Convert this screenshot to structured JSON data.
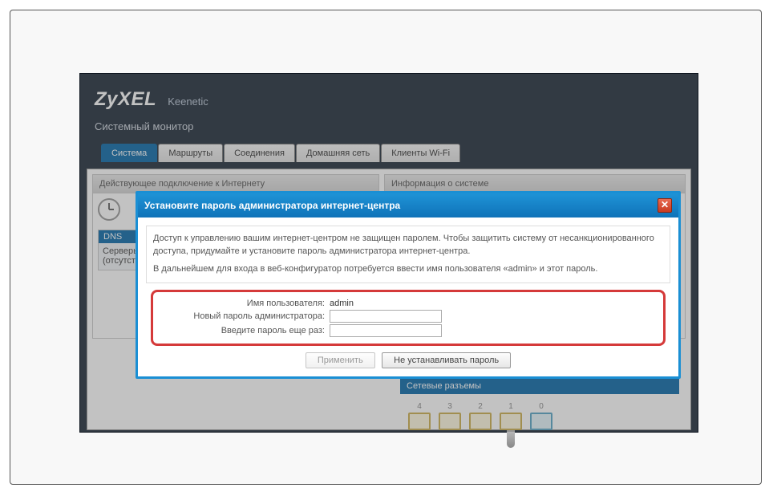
{
  "brand": {
    "logo": "ZyXEL",
    "model": "Keenetic"
  },
  "subtitle": "Системный монитор",
  "tabs": [
    "Система",
    "Маршруты",
    "Соединения",
    "Домашняя сеть",
    "Клиенты Wi-Fi"
  ],
  "active_tab": 0,
  "panels": {
    "left_title": "Действующее подключение к Интернету",
    "right_title": "Информация о системе"
  },
  "side": {
    "dns_title": "DNS",
    "servers_label": "Серверы",
    "servers_value": "(отсутствуют)"
  },
  "network": {
    "title": "Сетевые разъемы",
    "ports": [
      "4",
      "3",
      "2",
      "1",
      "0"
    ]
  },
  "dialog": {
    "title": "Установите пароль администратора интернет-центра",
    "paragraph1": "Доступ к управлению вашим интернет-центром не защищен паролем. Чтобы защитить систему от несанкционированного доступа, придумайте и установите пароль администратора интернет-центра.",
    "paragraph2": "В дальнейшем для входа в веб-конфигуратор потребуется ввести имя пользователя «admin» и этот пароль.",
    "username_label": "Имя пользователя:",
    "username_value": "admin",
    "password_label": "Новый пароль администратора:",
    "confirm_label": "Введите пароль еще раз:",
    "apply_btn": "Применить",
    "skip_btn": "Не устанавливать пароль"
  }
}
